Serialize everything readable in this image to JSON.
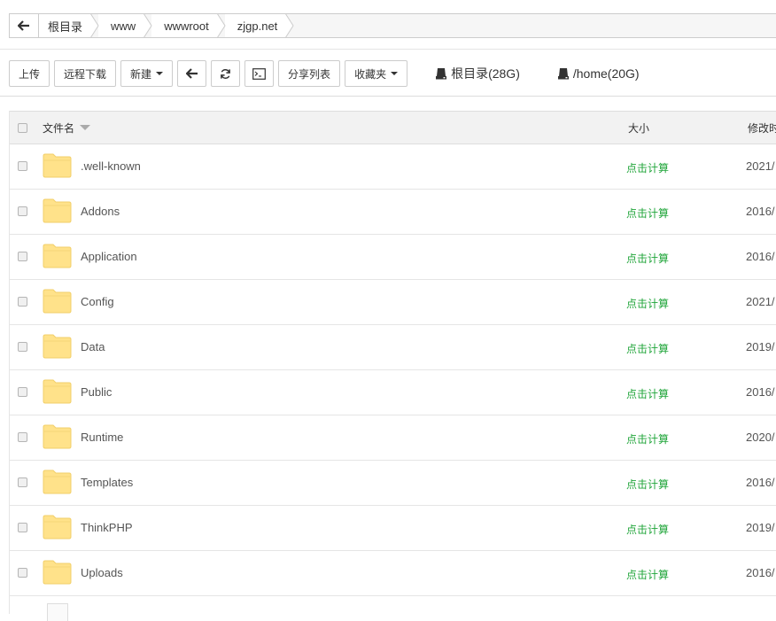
{
  "breadcrumb": {
    "items": [
      "根目录",
      "www",
      "wwwroot",
      "zjgp.net"
    ]
  },
  "toolbar": {
    "upload": "上传",
    "remote_download": "远程下载",
    "new": "新建",
    "share_list": "分享列表",
    "favorites": "收藏夹"
  },
  "disks": [
    {
      "label": "根目录(28G)"
    },
    {
      "label": "/home(20G)"
    }
  ],
  "table": {
    "col_name": "文件名",
    "col_size": "大小",
    "col_time": "修改时",
    "rows": [
      {
        "name": ".well-known",
        "size": "点击计算",
        "time": "2021/"
      },
      {
        "name": "Addons",
        "size": "点击计算",
        "time": "2016/"
      },
      {
        "name": "Application",
        "size": "点击计算",
        "time": "2016/"
      },
      {
        "name": "Config",
        "size": "点击计算",
        "time": "2021/"
      },
      {
        "name": "Data",
        "size": "点击计算",
        "time": "2019/"
      },
      {
        "name": "Public",
        "size": "点击计算",
        "time": "2016/"
      },
      {
        "name": "Runtime",
        "size": "点击计算",
        "time": "2020/"
      },
      {
        "name": "Templates",
        "size": "点击计算",
        "time": "2016/"
      },
      {
        "name": "ThinkPHP",
        "size": "点击计算",
        "time": "2019/"
      },
      {
        "name": "Uploads",
        "size": "点击计算",
        "time": "2016/"
      }
    ]
  },
  "colors": {
    "accent_green": "#20a53a",
    "folder_yellow": "#ffe28a"
  }
}
